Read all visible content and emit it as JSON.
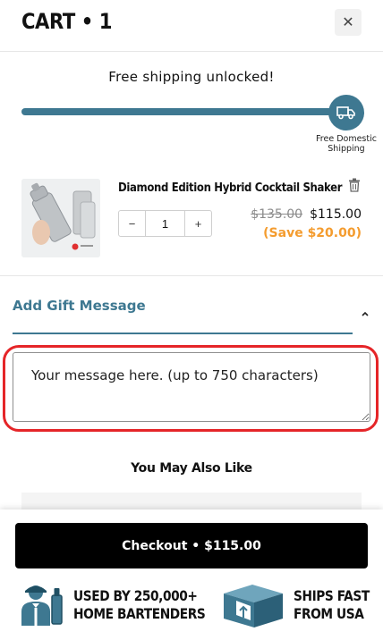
{
  "header": {
    "title": "CART • 1",
    "close_glyph": "✕"
  },
  "shipping": {
    "message": "Free shipping unlocked!",
    "progress_percent": 100,
    "goal_label": "Free Domestic Shipping",
    "accent_color": "#3e7891"
  },
  "cart_item": {
    "name": "Diamond Edition Hybrid Cocktail Shaker",
    "quantity": "1",
    "minus_label": "−",
    "plus_label": "+",
    "compare_price": "$135.00",
    "price": "$115.00",
    "savings": "(Save $20.00)",
    "savings_color": "#f49c2f"
  },
  "gift_message": {
    "title": "Add Gift Message",
    "placeholder": "Your message here. (up to 750 characters)",
    "value": ""
  },
  "recommendations": {
    "title": "You May Also Like"
  },
  "footer": {
    "checkout_label": "Checkout • $115.00",
    "badges": [
      {
        "icon": "bartender-icon",
        "line1": "USED BY 250,000+",
        "line2": "HOME BARTENDERS"
      },
      {
        "icon": "shipping-box-icon",
        "line1": "SHIPS FAST",
        "line2": "FROM USA"
      }
    ]
  }
}
